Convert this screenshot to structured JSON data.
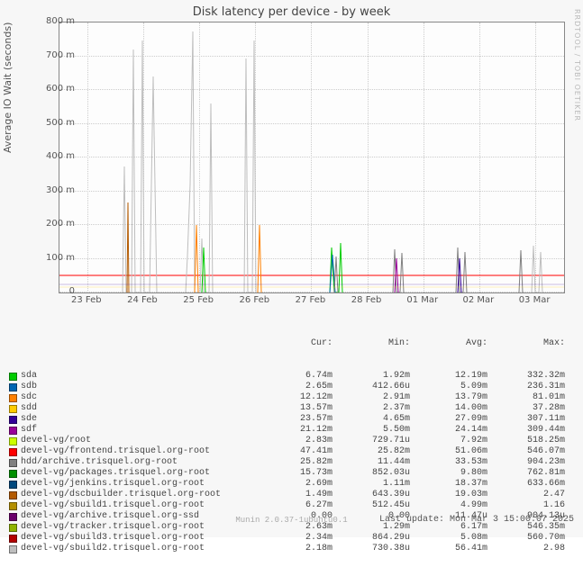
{
  "chart_data": {
    "type": "line",
    "title": "Disk latency per device - by week",
    "ylabel": "Average IO Wait (seconds)",
    "ylim": [
      0,
      800
    ],
    "yunit": "m",
    "yticks": [
      0,
      100,
      200,
      300,
      400,
      500,
      600,
      700,
      800
    ],
    "categories": [
      "23 Feb",
      "24 Feb",
      "25 Feb",
      "26 Feb",
      "27 Feb",
      "28 Feb",
      "01 Mar",
      "02 Mar",
      "03 Mar"
    ],
    "series": [
      {
        "name": "sda",
        "color": "#00cc00",
        "cur": "6.74m",
        "min": "1.92m",
        "avg": "12.19m",
        "max": "332.32m"
      },
      {
        "name": "sdb",
        "color": "#0066b3",
        "cur": "2.65m",
        "min": "412.66u",
        "avg": "5.09m",
        "max": "236.31m"
      },
      {
        "name": "sdc",
        "color": "#ff8000",
        "cur": "12.12m",
        "min": "2.91m",
        "avg": "13.79m",
        "max": "81.01m"
      },
      {
        "name": "sdd",
        "color": "#ffcc00",
        "cur": "13.57m",
        "min": "2.37m",
        "avg": "14.00m",
        "max": "37.28m"
      },
      {
        "name": "sde",
        "color": "#330099",
        "cur": "23.57m",
        "min": "4.65m",
        "avg": "27.09m",
        "max": "307.11m"
      },
      {
        "name": "sdf",
        "color": "#990099",
        "cur": "21.12m",
        "min": "5.50m",
        "avg": "24.14m",
        "max": "309.44m"
      },
      {
        "name": "devel-vg/root",
        "color": "#ccff00",
        "cur": "2.83m",
        "min": "729.71u",
        "avg": "7.92m",
        "max": "518.25m"
      },
      {
        "name": "devel-vg/frontend.trisquel.org-root",
        "color": "#ff0000",
        "cur": "47.41m",
        "min": "25.82m",
        "avg": "51.06m",
        "max": "546.07m"
      },
      {
        "name": "hdd/archive.trisquel.org-root",
        "color": "#808080",
        "cur": "25.82m",
        "min": "11.44m",
        "avg": "33.53m",
        "max": "904.23m"
      },
      {
        "name": "devel-vg/packages.trisquel.org-root",
        "color": "#008f00",
        "cur": "15.73m",
        "min": "852.03u",
        "avg": "9.80m",
        "max": "762.81m"
      },
      {
        "name": "devel-vg/jenkins.trisquel.org-root",
        "color": "#00487d",
        "cur": "2.69m",
        "min": "1.11m",
        "avg": "18.37m",
        "max": "633.66m"
      },
      {
        "name": "devel-vg/dscbuilder.trisquel.org-root",
        "color": "#b35a00",
        "cur": "1.49m",
        "min": "643.39u",
        "avg": "19.03m",
        "max": "2.47"
      },
      {
        "name": "devel-vg/sbuild1.trisquel.org-root",
        "color": "#b38f00",
        "cur": "6.27m",
        "min": "512.45u",
        "avg": "4.99m",
        "max": "1.16"
      },
      {
        "name": "devel-vg/archive.trisquel.org-ssd",
        "color": "#6b006b",
        "cur": "0.00",
        "min": "0.00",
        "avg": "11.47u",
        "max": "904.13u"
      },
      {
        "name": "devel-vg/tracker.trisquel.org-root",
        "color": "#8fb300",
        "cur": "2.63m",
        "min": "1.29m",
        "avg": "6.17m",
        "max": "546.35m"
      },
      {
        "name": "devel-vg/sbuild3.trisquel.org-root",
        "color": "#b30000",
        "cur": "2.34m",
        "min": "864.29u",
        "avg": "5.08m",
        "max": "560.70m"
      },
      {
        "name": "devel-vg/sbuild2.trisquel.org-root",
        "color": "#bebebe",
        "cur": "2.18m",
        "min": "730.38u",
        "avg": "56.41m",
        "max": "2.98"
      }
    ]
  },
  "legend_headers": {
    "cur": "Cur:",
    "min": "Min:",
    "avg": "Avg:",
    "max": "Max:"
  },
  "watermark": "RRDTOOL / TOBI OETIKER",
  "footer_tool": "Munin 2.0.37-1ubuntu0.1",
  "footer_update": "Last update: Mon Mar  3 15:00:07 2025"
}
